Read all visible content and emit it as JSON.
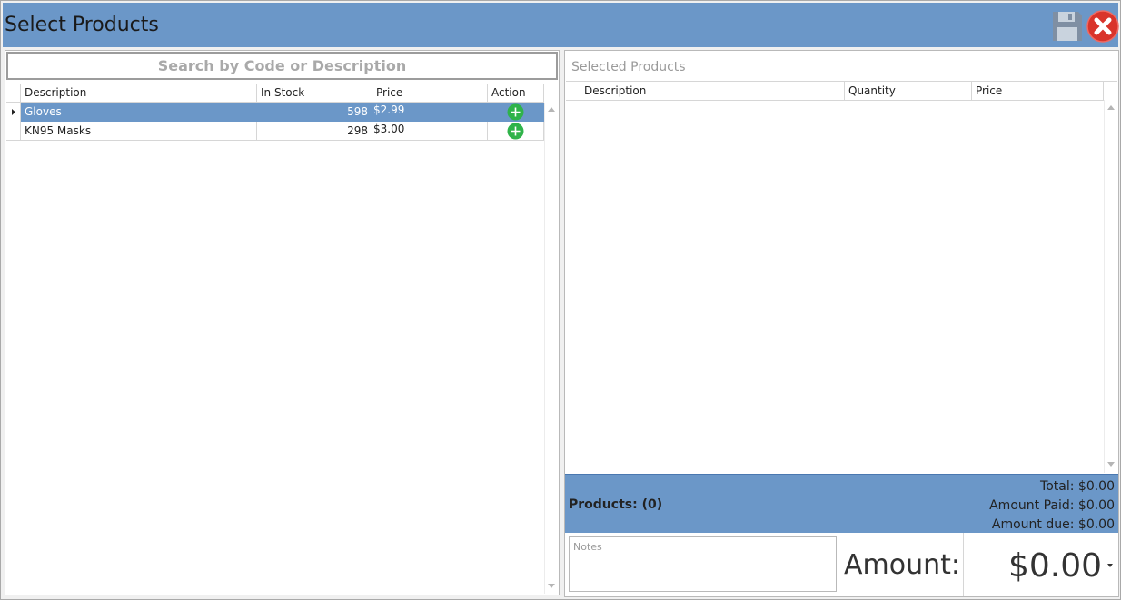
{
  "window": {
    "title": "Select Products",
    "colors": {
      "accent": "#6b97c8",
      "close": "#d9342b",
      "add": "#2fb34a"
    }
  },
  "search": {
    "placeholder": "Search by Code or Description"
  },
  "products_grid": {
    "columns": [
      "Description",
      "In Stock",
      "Price",
      "Action"
    ],
    "rows": [
      {
        "description": "Gloves",
        "in_stock": "598",
        "price": "$2.99",
        "selected": true,
        "action_icon": "plus-circle-icon"
      },
      {
        "description": "KN95 Masks",
        "in_stock": "298",
        "price": "$3.00",
        "selected": false,
        "action_icon": "plus-circle-icon"
      }
    ]
  },
  "selected_panel": {
    "title": "Selected Products",
    "columns": [
      "Description",
      "Quantity",
      "Price"
    ],
    "rows": []
  },
  "summary": {
    "products_count": "Products: (0)",
    "total": "Total: $0.00",
    "amount_paid": "Amount Paid: $0.00",
    "amount_due": "Amount due: $0.00"
  },
  "notes": {
    "placeholder": "Notes",
    "value": ""
  },
  "amount": {
    "label": "Amount:",
    "value": "$0.00"
  }
}
